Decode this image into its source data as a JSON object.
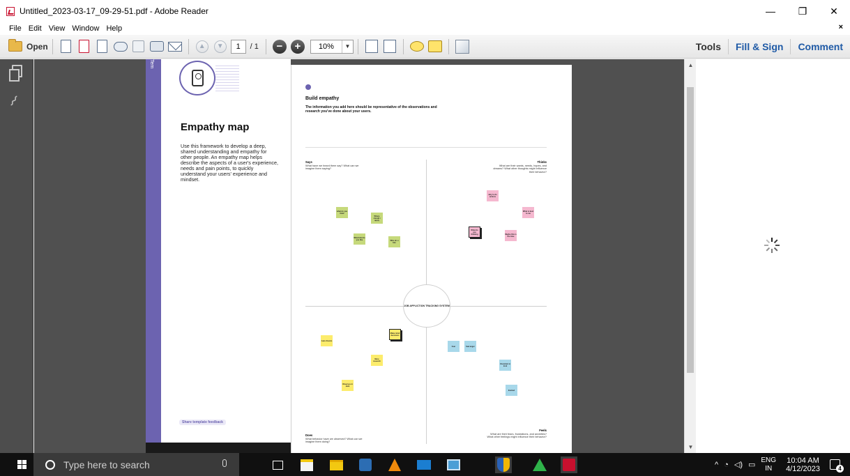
{
  "window": {
    "title": "Untitled_2023-03-17_09-29-51.pdf - Adobe Reader",
    "minimize": "—",
    "restore": "❐",
    "close": "✕"
  },
  "menu": {
    "items": [
      "File",
      "Edit",
      "View",
      "Window",
      "Help"
    ],
    "close_doc": "×"
  },
  "toolbar": {
    "open_label": "Open",
    "page_current": "1",
    "page_total": "/ 1",
    "zoom_value": "10%",
    "zoom_out": "−",
    "zoom_in": "+",
    "tools": "Tools",
    "fill_sign": "Fill & Sign",
    "comment": "Comment"
  },
  "left_page": {
    "tab_text": "Tem",
    "title": "Empathy map",
    "description": "Use this framework to develop a deep, shared understanding and empathy for other people. An empathy map helps describe the aspects of a user's experience, needs and pain points, to quickly understand your users' experience and mindset.",
    "feedback": "Share template feedback"
  },
  "main_page": {
    "title": "Build empathy",
    "subtitle": "The information you add here should be representative of the observations and research you've done about your users.",
    "center": "JOB APPLICTION TRACKING SYSTEM",
    "says": {
      "title": "Says",
      "desc": "What have we heard them say? What can we imagine them saying?"
    },
    "thinks": {
      "title": "Thinks",
      "desc": "What are their wants, needs, hopes, and dreams? What other thoughts might influence their behavior?"
    },
    "does": {
      "title": "Does",
      "desc": "What behavior have we observed? What can we imagine them doing?"
    },
    "feels": {
      "title": "Feels",
      "desc": "What are their fears, frustrations, and anxieties? What other feelings might influence their behavior?"
    },
    "stickies": {
      "s1": "what do you think",
      "s2": "Where should i apply",
      "s3": "What kind do you like",
      "s4": "Who do u hire",
      "t1": "why to do actions",
      "t2": "What is best to me",
      "t3": "What do you thinking",
      "t4": "Maybe this is the time",
      "d1": "Make mind decisions",
      "d2": "Asks friends",
      "d3": "More research",
      "d4": "Observes in dark",
      "f1": "Fear",
      "f2": "Sad anger",
      "f3": "Uncertain to look",
      "f4": "Excited"
    }
  },
  "taskbar": {
    "search_placeholder": "Type here to search",
    "lang_top": "ENG",
    "lang_bottom": "IN",
    "time": "10:04 AM",
    "date": "4/12/2023",
    "notif_count": "4",
    "tray_caret": "^"
  }
}
